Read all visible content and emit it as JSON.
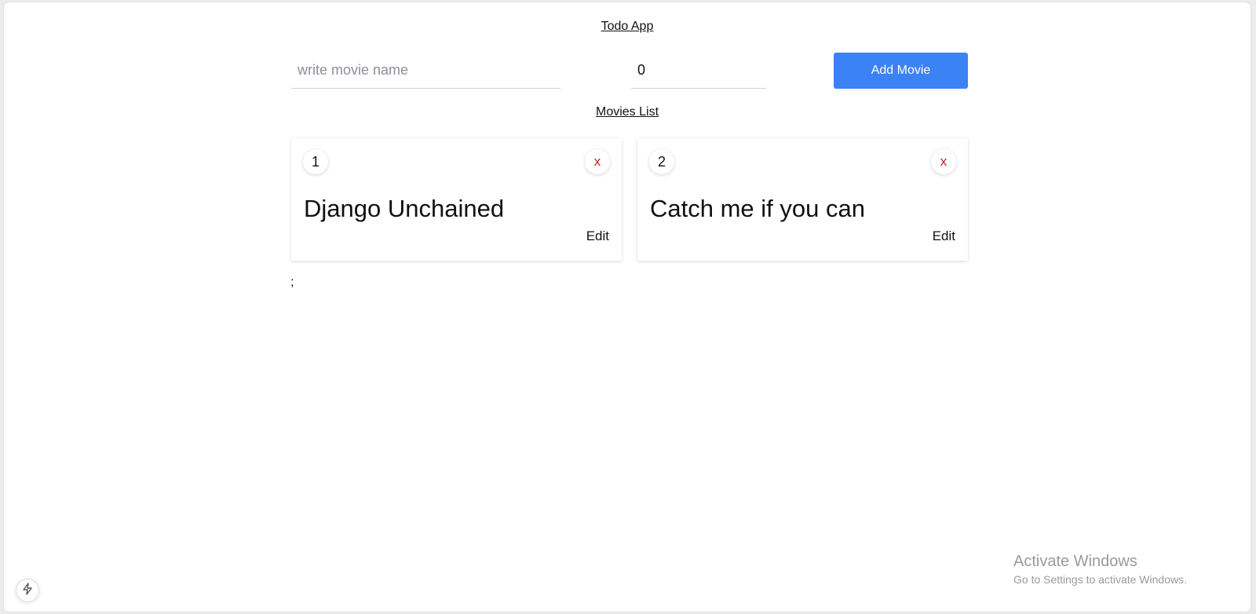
{
  "app": {
    "title": "Todo App"
  },
  "form": {
    "movie_name_placeholder": "write movie name",
    "movie_name_value": "",
    "rating_value": "0",
    "add_button_label": "Add Movie"
  },
  "list": {
    "title": "Movies List",
    "movies": [
      {
        "number": "1",
        "name": "Django Unchained",
        "delete_label": "x",
        "edit_label": "Edit"
      },
      {
        "number": "2",
        "name": "Catch me if you can",
        "delete_label": "x",
        "edit_label": "Edit"
      }
    ],
    "trailing_text": ";"
  },
  "os_watermark": {
    "title": "Activate Windows",
    "subtitle": "Go to Settings to activate Windows."
  },
  "colors": {
    "accent": "#3b82f6",
    "delete": "#c81e1e"
  },
  "icons": {
    "devtools": "lightning-bolt-icon"
  }
}
